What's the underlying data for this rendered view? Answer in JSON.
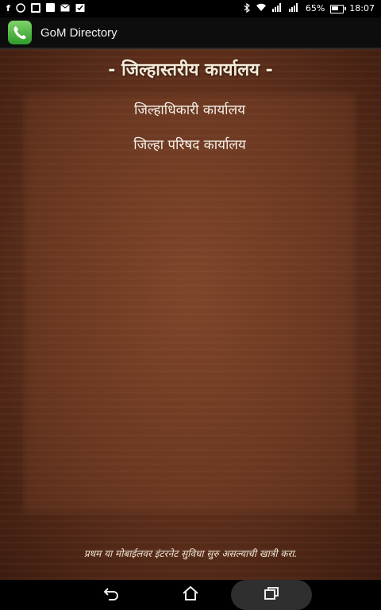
{
  "status_bar": {
    "battery": "65%",
    "time": "18:07",
    "icons_left": [
      "notification-f-icon",
      "whatsapp-icon",
      "message-icon",
      "image-icon",
      "mail-icon",
      "check-icon"
    ],
    "icons_right": [
      "bluetooth-icon",
      "wifi-icon",
      "signal-icon",
      "signal-icon-2",
      "battery-icon"
    ]
  },
  "app": {
    "title": "GoM Directory",
    "icon": "phone-icon",
    "accent": "#3fae3a"
  },
  "main": {
    "heading": "- जिल्हास्तरीय कार्यालय -",
    "items": [
      {
        "label": "जिल्हाधिकारी कार्यालय"
      },
      {
        "label": "जिल्हा परिषद कार्यालय"
      }
    ],
    "footer_note": "प्रथम या मोबाईलवर इंटरनेट सुविधा सुरु असल्याची खात्री करा."
  },
  "nav": {
    "icons": [
      "back-icon",
      "home-icon",
      "recent-apps-icon"
    ]
  }
}
